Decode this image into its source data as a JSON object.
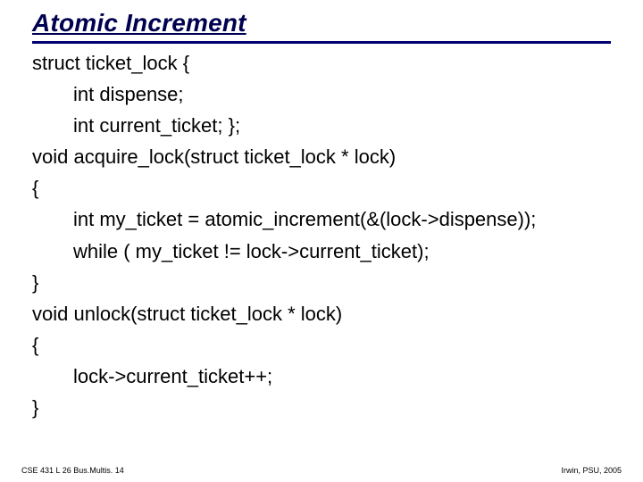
{
  "title": "Atomic Increment",
  "code": {
    "l0": "struct ticket_lock {",
    "l1": "int dispense;",
    "l2": "int current_ticket; };",
    "l3": "void acquire_lock(struct ticket_lock * lock)",
    "l4": "{",
    "l5": "int my_ticket = atomic_increment(&(lock->dispense));",
    "l6": "while ( my_ticket != lock->current_ticket);",
    "l7": "}",
    "l8": "void unlock(struct ticket_lock * lock)",
    "l9": "{",
    "l10": "lock->current_ticket++;",
    "l11": "}"
  },
  "footer": {
    "left": "CSE 431  L 26 Bus.Multis. 14",
    "right": "Irwin, PSU, 2005"
  }
}
